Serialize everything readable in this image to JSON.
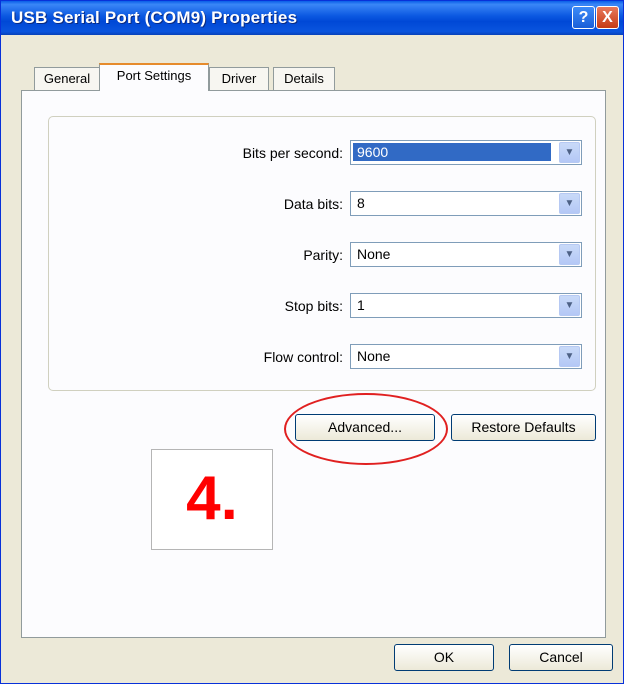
{
  "window": {
    "title": "USB Serial Port (COM9) Properties"
  },
  "titlebar_buttons": {
    "help": "?",
    "close": "X"
  },
  "tabs": [
    {
      "label": "General"
    },
    {
      "label": "Port Settings"
    },
    {
      "label": "Driver"
    },
    {
      "label": "Details"
    }
  ],
  "settings": {
    "bits_per_second": {
      "label": "Bits per second:",
      "value": "9600"
    },
    "data_bits": {
      "label": "Data bits:",
      "value": "8"
    },
    "parity": {
      "label": "Parity:",
      "value": "None"
    },
    "stop_bits": {
      "label": "Stop bits:",
      "value": "1"
    },
    "flow_control": {
      "label": "Flow control:",
      "value": "None"
    }
  },
  "buttons": {
    "advanced": "Advanced...",
    "restore_defaults": "Restore Defaults",
    "ok": "OK",
    "cancel": "Cancel"
  },
  "annotation": {
    "step": "4."
  },
  "colors": {
    "title_bar": "#0a57e0",
    "selection": "#316ac5",
    "annotation": "#ff0000"
  }
}
